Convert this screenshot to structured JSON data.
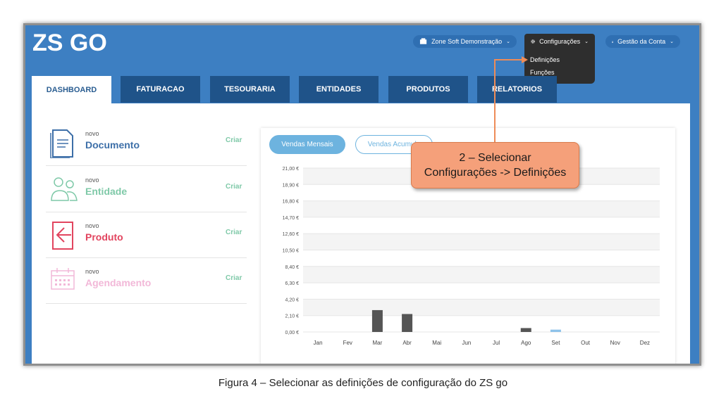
{
  "header": {
    "logo_text": "ZS GO",
    "company": "Zone Soft Demonstração",
    "config": "Configurações",
    "account": "Gestão da Conta"
  },
  "config_menu": [
    "Definições",
    "Funções"
  ],
  "tabs": [
    "DASHBOARD",
    "FATURACAO",
    "TESOURARIA",
    "ENTIDADES",
    "PRODUTOS",
    "RELATORIOS"
  ],
  "create_items": [
    {
      "small": "novo",
      "label": "Documento",
      "action": "Criar",
      "color": "#3d6fa8"
    },
    {
      "small": "novo",
      "label": "Entidade",
      "action": "Criar",
      "color": "#7fc9a8"
    },
    {
      "small": "novo",
      "label": "Produto",
      "action": "Criar",
      "color": "#e2455f"
    },
    {
      "small": "novo",
      "label": "Agendamento",
      "action": "Criar",
      "color": "#f2b8d8"
    }
  ],
  "chart_tabs": {
    "monthly": "Vendas Mensais",
    "cumulative": "Vendas Acumula"
  },
  "chart_data": {
    "type": "bar",
    "categories": [
      "Jan",
      "Fev",
      "Mar",
      "Abr",
      "Mai",
      "Jun",
      "Jul",
      "Ago",
      "Set",
      "Out",
      "Nov",
      "Dez"
    ],
    "series": [
      {
        "values": [
          0,
          0,
          2.8,
          2.3,
          0,
          0,
          0,
          0.5,
          0,
          0,
          0,
          0
        ],
        "color": "#555555"
      },
      {
        "values": [
          0,
          0,
          0,
          0,
          0,
          0,
          0,
          0,
          0.3,
          0,
          0,
          0
        ],
        "color": "#8ec3ea"
      }
    ],
    "yticks": [
      "0,00 €",
      "2,10 €",
      "4,20 €",
      "6,30 €",
      "8,40 €",
      "10,50 €",
      "12,60 €",
      "14,70 €",
      "16,80 €",
      "18,90 €",
      "21,00 €"
    ],
    "ylim": [
      0,
      21
    ]
  },
  "annotation": {
    "line1": "2 – Selecionar",
    "line2": "Configurações -> Definições"
  },
  "caption": "Figura 4 – Selecionar as definições de configuração do ZS go",
  "colors": {
    "primary": "#3d7fc2",
    "tab_dark": "#1f5389",
    "annotation": "#f5a07a",
    "arrow": "#ee8c58"
  }
}
